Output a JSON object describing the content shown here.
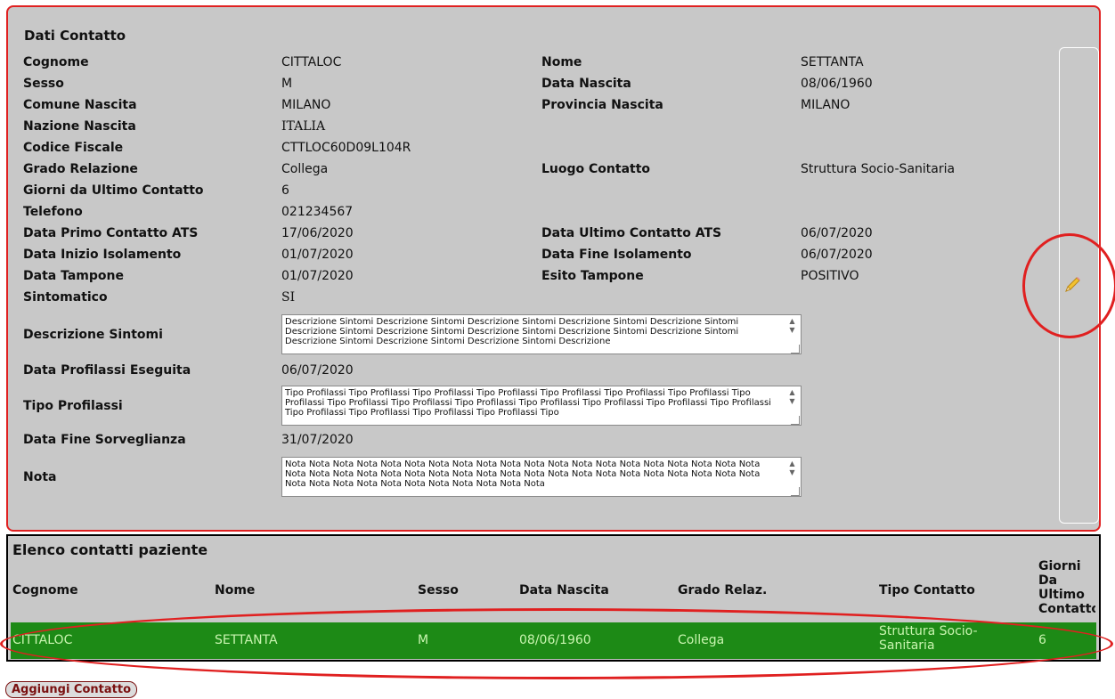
{
  "detail": {
    "title": "Dati Contatto",
    "rows": [
      {
        "l1": "Cognome",
        "v1": "CITTALOC",
        "l2": "Nome",
        "v2": "SETTANTA"
      },
      {
        "l1": "Sesso",
        "v1": "M",
        "l2": "Data Nascita",
        "v2": "08/06/1960"
      },
      {
        "l1": "Comune Nascita",
        "v1": "MILANO",
        "l2": "Provincia Nascita",
        "v2": "MILANO"
      },
      {
        "l1": "Nazione Nascita",
        "v1": "ITALIA"
      },
      {
        "l1": "Codice Fiscale",
        "v1": "CTTLOC60D09L104R"
      },
      {
        "l1": "Grado Relazione",
        "v1": "Collega",
        "l2": "Luogo Contatto",
        "v2": "Struttura Socio-Sanitaria"
      },
      {
        "l1": "Giorni da Ultimo Contatto",
        "v1": "6"
      },
      {
        "l1": "Telefono",
        "v1": "021234567"
      },
      {
        "l1": "Data Primo Contatto ATS",
        "v1": "17/06/2020",
        "l2": "Data Ultimo Contatto ATS",
        "v2": "06/07/2020"
      },
      {
        "l1": "Data Inizio Isolamento",
        "v1": "01/07/2020",
        "l2": "Data Fine Isolamento",
        "v2": "06/07/2020"
      },
      {
        "l1": "Data Tampone",
        "v1": "01/07/2020",
        "l2": "Esito Tampone",
        "v2": "POSITIVO"
      },
      {
        "l1": "Sintomatico",
        "v1": "SI"
      }
    ],
    "descrizione_sintomi": {
      "label": "Descrizione Sintomi",
      "value": "Descrizione Sintomi Descrizione Sintomi Descrizione Sintomi Descrizione Sintomi Descrizione Sintomi Descrizione Sintomi Descrizione Sintomi Descrizione Sintomi Descrizione Sintomi Descrizione Sintomi Descrizione Sintomi Descrizione Sintomi Descrizione Sintomi Descrizione"
    },
    "data_profilassi": {
      "label": "Data Profilassi Eseguita",
      "value": "06/07/2020"
    },
    "tipo_profilassi": {
      "label": "Tipo Profilassi",
      "value": "Tipo Profilassi Tipo Profilassi Tipo Profilassi Tipo Profilassi Tipo Profilassi Tipo Profilassi Tipo Profilassi Tipo Profilassi Tipo Profilassi Tipo Profilassi Tipo Profilassi Tipo Profilassi Tipo Profilassi Tipo Profilassi Tipo Profilassi Tipo Profilassi Tipo Profilassi Tipo Profilassi Tipo Profilassi Tipo"
    },
    "data_fine_sorveglianza": {
      "label": "Data Fine Sorveglianza",
      "value": "31/07/2020"
    },
    "nota": {
      "label": "Nota",
      "value": "Nota Nota Nota Nota Nota Nota Nota Nota Nota Nota Nota Nota Nota Nota Nota Nota Nota Nota Nota Nota Nota Nota Nota Nota Nota Nota Nota Nota Nota Nota Nota Nota Nota Nota Nota Nota Nota Nota Nota Nota Nota Nota Nota Nota Nota Nota Nota Nota Nota Nota Nota"
    },
    "edit_icon": "pencil-icon"
  },
  "list": {
    "title": "Elenco contatti paziente",
    "headers": [
      "Cognome",
      "Nome",
      "Sesso",
      "Data Nascita",
      "Grado Relaz.",
      "Tipo Contatto",
      "Giorni Da Ultimo Contatto"
    ],
    "rows": [
      {
        "cognome": "CITTALOC",
        "nome": "SETTANTA",
        "sesso": "M",
        "data_nascita": "08/06/1960",
        "grado": "Collega",
        "tipo": "Struttura Socio-Sanitaria",
        "giorni": "6"
      }
    ]
  },
  "add_button_label": "Aggiungi Contatto",
  "colors": {
    "panel_bg": "#c8c8c8",
    "annotation_red": "#e02020",
    "selected_row": "#1d8a16",
    "button_text": "#7a1010"
  }
}
